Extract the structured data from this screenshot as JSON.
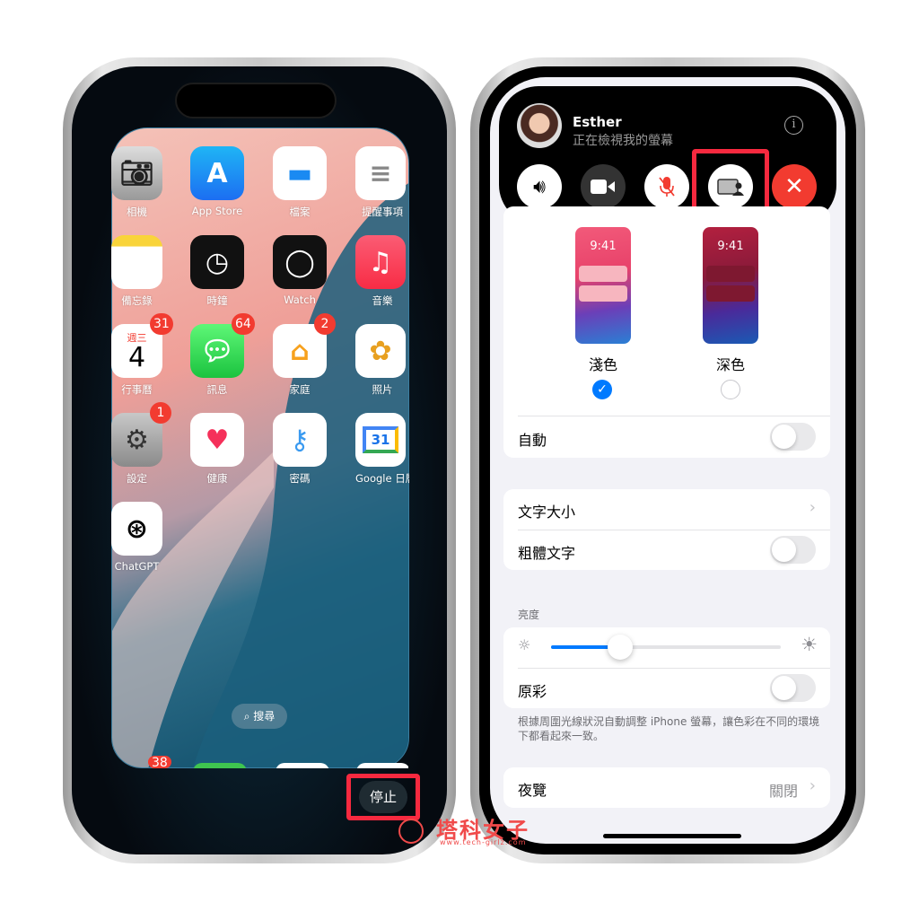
{
  "left_phone": {
    "apps": [
      {
        "label": "相機",
        "icon": "camera-icon"
      },
      {
        "label": "App Store",
        "icon": "app-store-icon"
      },
      {
        "label": "檔案",
        "icon": "files-icon"
      },
      {
        "label": "提醒事項",
        "icon": "reminders-icon"
      },
      {
        "label": "備忘錄",
        "icon": "notes-icon"
      },
      {
        "label": "時鐘",
        "icon": "clock-icon"
      },
      {
        "label": "Watch",
        "icon": "watch-icon"
      },
      {
        "label": "音樂",
        "icon": "music-icon"
      },
      {
        "label": "行事曆",
        "icon": "calendar-icon",
        "badge": "31",
        "weekday": "週三",
        "day": "4"
      },
      {
        "label": "訊息",
        "icon": "messages-icon",
        "badge": "64"
      },
      {
        "label": "家庭",
        "icon": "home-icon",
        "badge": "2"
      },
      {
        "label": "照片",
        "icon": "photos-icon"
      },
      {
        "label": "設定",
        "icon": "settings-icon",
        "badge": "1"
      },
      {
        "label": "健康",
        "icon": "health-icon"
      },
      {
        "label": "密碼",
        "icon": "passwords-icon"
      },
      {
        "label": "Google 日曆",
        "icon": "google-calendar-icon",
        "day": "31"
      },
      {
        "label": "ChatGPT",
        "icon": "chatgpt-icon"
      }
    ],
    "search_label": "搜尋",
    "dock_badge": "38",
    "stop_button": "停止"
  },
  "right_phone": {
    "call": {
      "name": "Esther",
      "status": "正在檢視我的螢幕",
      "buttons": [
        "speaker-icon",
        "video-icon",
        "mic-muted-icon",
        "screen-share-icon",
        "end-call-icon"
      ]
    },
    "appearance": {
      "light": {
        "label": "淺色",
        "time": "9:41",
        "selected": true
      },
      "dark": {
        "label": "深色",
        "time": "9:41",
        "selected": false
      }
    },
    "auto_label": "自動",
    "text_size_label": "文字大小",
    "bold_text_label": "粗體文字",
    "brightness_header": "亮度",
    "brightness_value": 0.3,
    "true_tone_label": "原彩",
    "true_tone_footer": "根據周圍光線狀況自動調整 iPhone 螢幕，讓色彩在不同的環境下都看起來一致。",
    "night_shift_label": "夜覽",
    "night_shift_value": "關閉"
  },
  "watermark": {
    "text": "塔科女子",
    "url": "www.tech-girlz.com"
  },
  "colors": {
    "highlight": "#f7293f",
    "accent": "#007aff",
    "end_call": "#f23b30"
  }
}
